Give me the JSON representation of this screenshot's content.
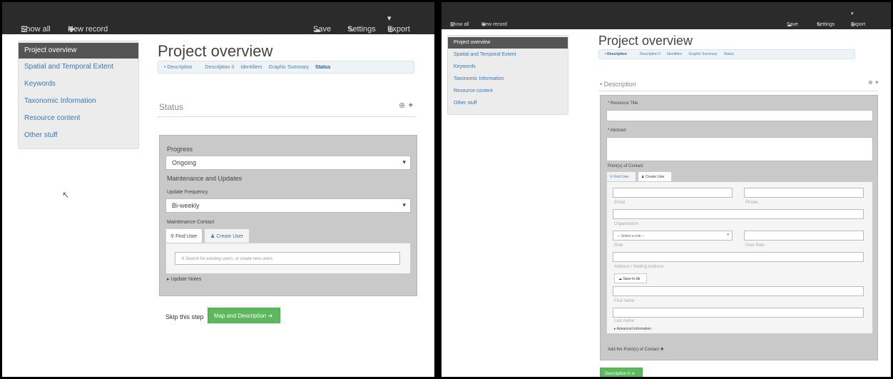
{
  "nav": {
    "show_all": "Show all",
    "new_record": "New record",
    "save": "Save",
    "settings": "Settings",
    "export": "Export"
  },
  "sidebar": {
    "items": [
      {
        "label": "Project overview"
      },
      {
        "label": "Spatial and Temporal Extent"
      },
      {
        "label": "Keywords"
      },
      {
        "label": "Taxonomic Information"
      },
      {
        "label": "Resource content"
      },
      {
        "label": "Other stuff"
      }
    ]
  },
  "page_title": "Project overview",
  "subtabs": [
    "Description",
    "Description II",
    "Identifiers",
    "Graphic Summary",
    "Status"
  ],
  "left": {
    "section_title": "Status",
    "progress_label": "Progress",
    "progress_value": "Ongoing",
    "maintenance_title": "Maintenance and Updates",
    "update_frequency_label": "Update Frequency",
    "update_frequency_value": "Bi-weekly",
    "maintenance_contact_label": "Maintenance Contact",
    "find_user_tab": "Find User",
    "create_user_tab": "Create User",
    "search_placeholder": "Search for existing users, or create new users",
    "update_notes": "Update Notes",
    "skip_button": "Skip this step",
    "next_button": "Map and Description"
  },
  "right": {
    "section_title": "Description",
    "resource_title_label": "Resource Title",
    "abstract_label": "Abstract",
    "poc_label": "Point(s) of Contact",
    "find_user_tab": "Find User",
    "create_user_tab": "Create User",
    "field_email": "Email",
    "field_phone": "Phone",
    "field_organization": "Organization",
    "select_role": "-- Select a role --",
    "field_role": "Role",
    "field_user_role": "User Role",
    "field_address": "Address / Mailing Address",
    "save_to_db": "Save to db",
    "field_first_name": "First name",
    "field_last_name": "Last name",
    "advanced": "Advanced information",
    "add_poc": "Add the Point(s) of Contact",
    "next_button": "Description II"
  }
}
